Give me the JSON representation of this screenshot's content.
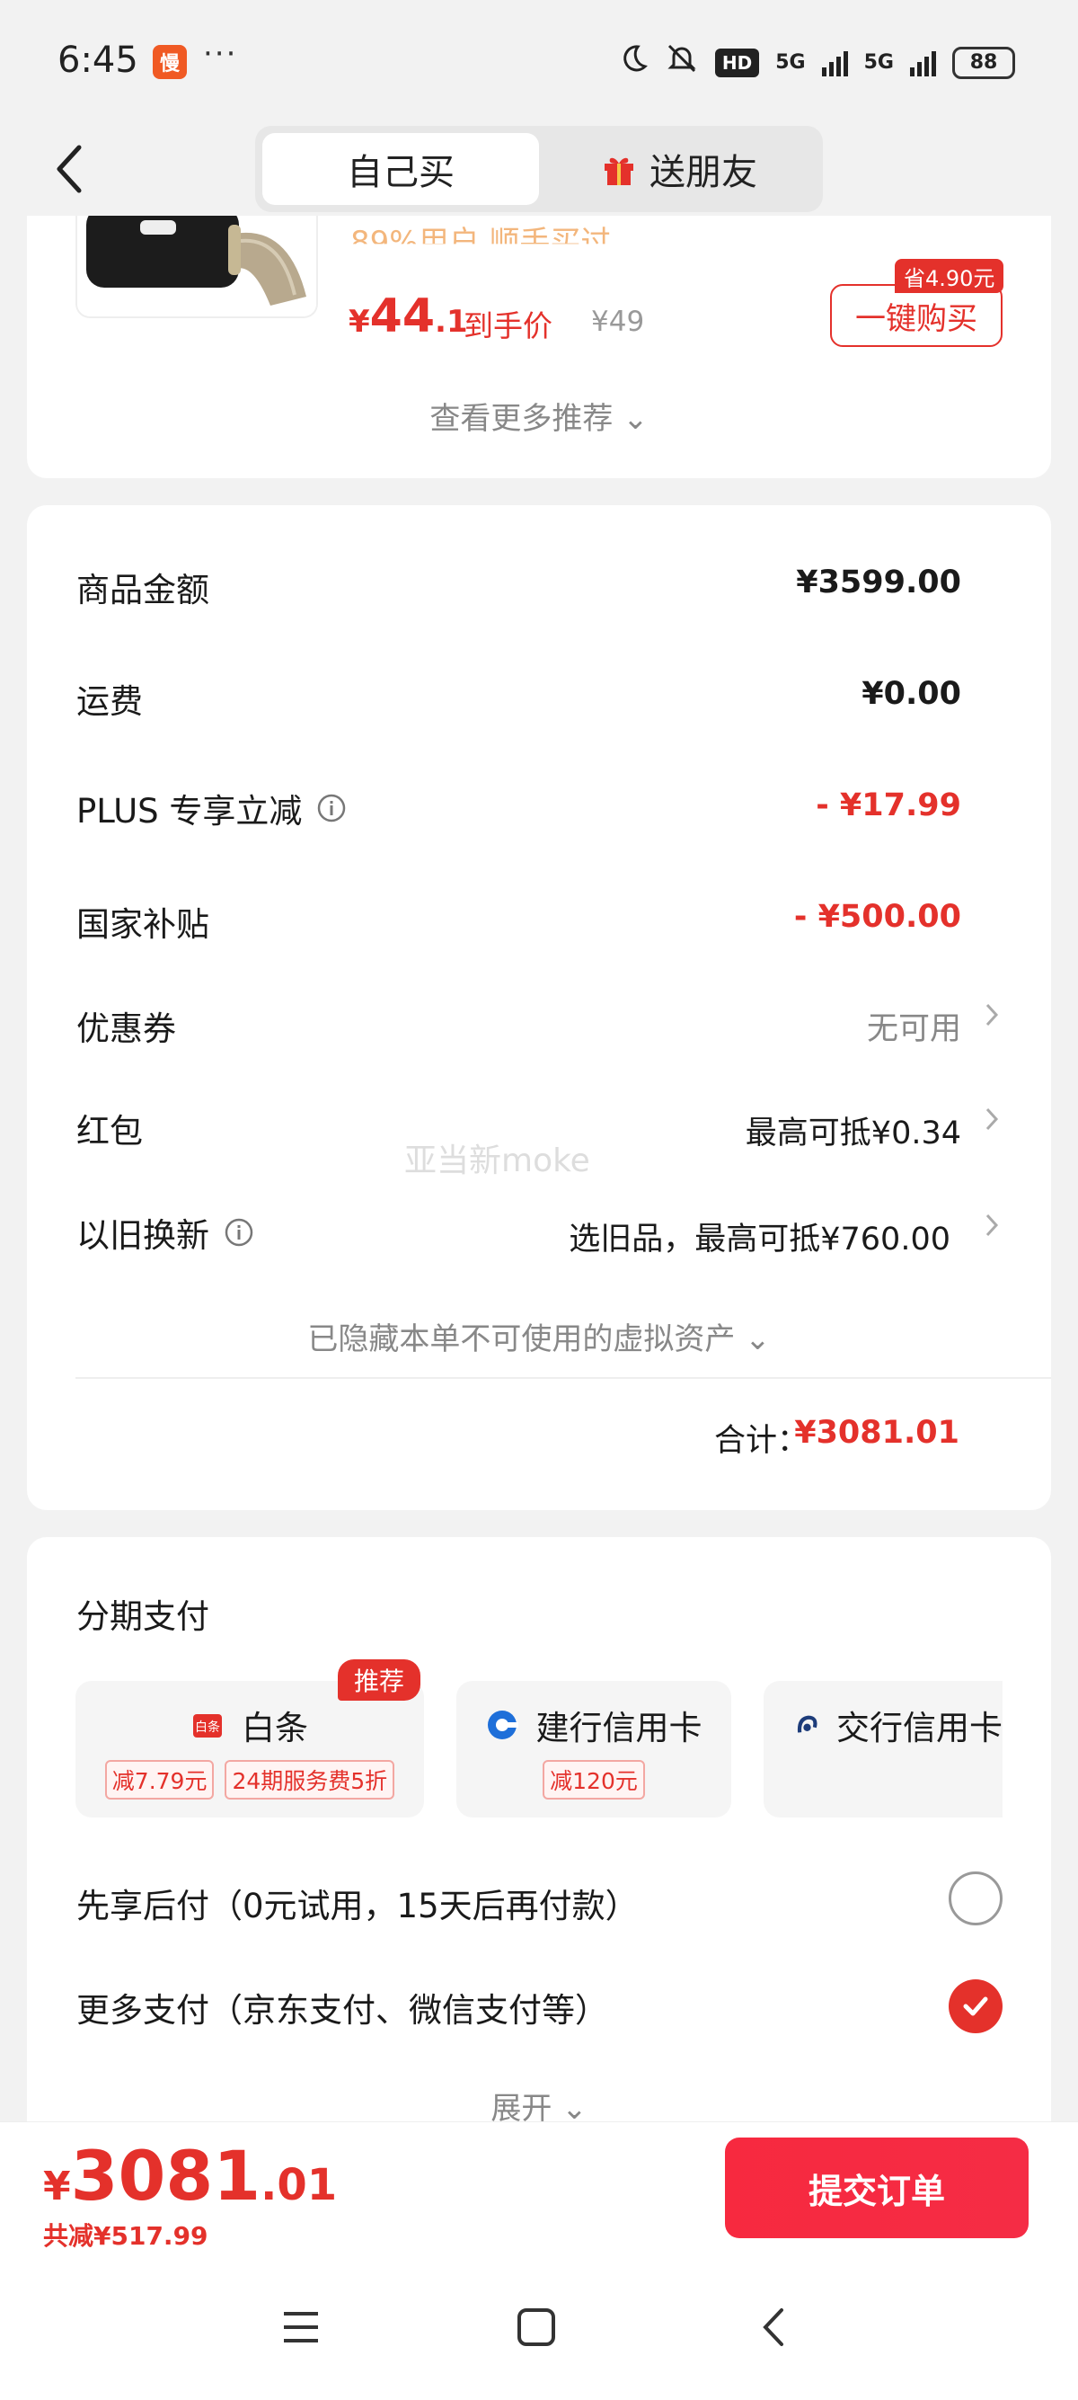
{
  "status_bar": {
    "time": "6:45",
    "app_badge": "慢",
    "more_dots": "···",
    "network_badge": "HD",
    "signal1": "5G",
    "signal2": "5G",
    "battery": "88"
  },
  "header": {
    "back_icon": "back-arrow-icon",
    "tabs": [
      {
        "label": "自己买",
        "active": true
      },
      {
        "label": "送朋友",
        "active": false,
        "icon": "gift-icon"
      }
    ]
  },
  "recommend": {
    "faded_text": "89%用户 顺手买过",
    "price_yen": "¥",
    "price_int": "44",
    "price_dec": ".1",
    "price_suffix": "到手价",
    "original_price": "¥49",
    "save_tag": "省4.90元",
    "buy_button": "一键购买",
    "more_link": "查看更多推荐 ⌄"
  },
  "summary": {
    "rows": [
      {
        "label": "商品金额",
        "value": "¥3599.00"
      },
      {
        "label": "运费",
        "value": "¥0.00"
      },
      {
        "label": "PLUS 专享立减",
        "value": "- ¥17.99"
      },
      {
        "label": "国家补贴",
        "value": "- ¥500.00"
      },
      {
        "label": "优惠券",
        "value": "无可用"
      },
      {
        "label": "红包",
        "value": "最高可抵¥0.34"
      },
      {
        "label": "以旧换新",
        "value": "选旧品，最高可抵¥760.00"
      }
    ],
    "watermark": "亚当新moke",
    "hidden_assets": "已隐藏本单不可使用的虚拟资产 ⌄",
    "total_label": "合计：",
    "total_value": "¥3081.01"
  },
  "installment": {
    "title": "分期支付",
    "recommend_badge": "推荐",
    "cards": [
      {
        "name": "白条",
        "tags": [
          "减7.79元",
          "24期服务费5折"
        ]
      },
      {
        "name": "建行信用卡",
        "tags": [
          "减120元"
        ]
      },
      {
        "name": "交行信用卡",
        "tags": []
      }
    ],
    "options": [
      {
        "label": "先享后付（0元试用，15天后再付款）",
        "selected": false
      },
      {
        "label": "更多支付（京东支付、微信支付等）",
        "selected": true
      }
    ],
    "expand": "展开 ⌄"
  },
  "bottom_bar": {
    "price_yen": "¥",
    "price_int": "3081",
    "price_dec": ".01",
    "saved": "共减¥517.99",
    "submit": "提交订单"
  },
  "colors": {
    "accent": "#e4312b",
    "submit": "#f7293f"
  }
}
